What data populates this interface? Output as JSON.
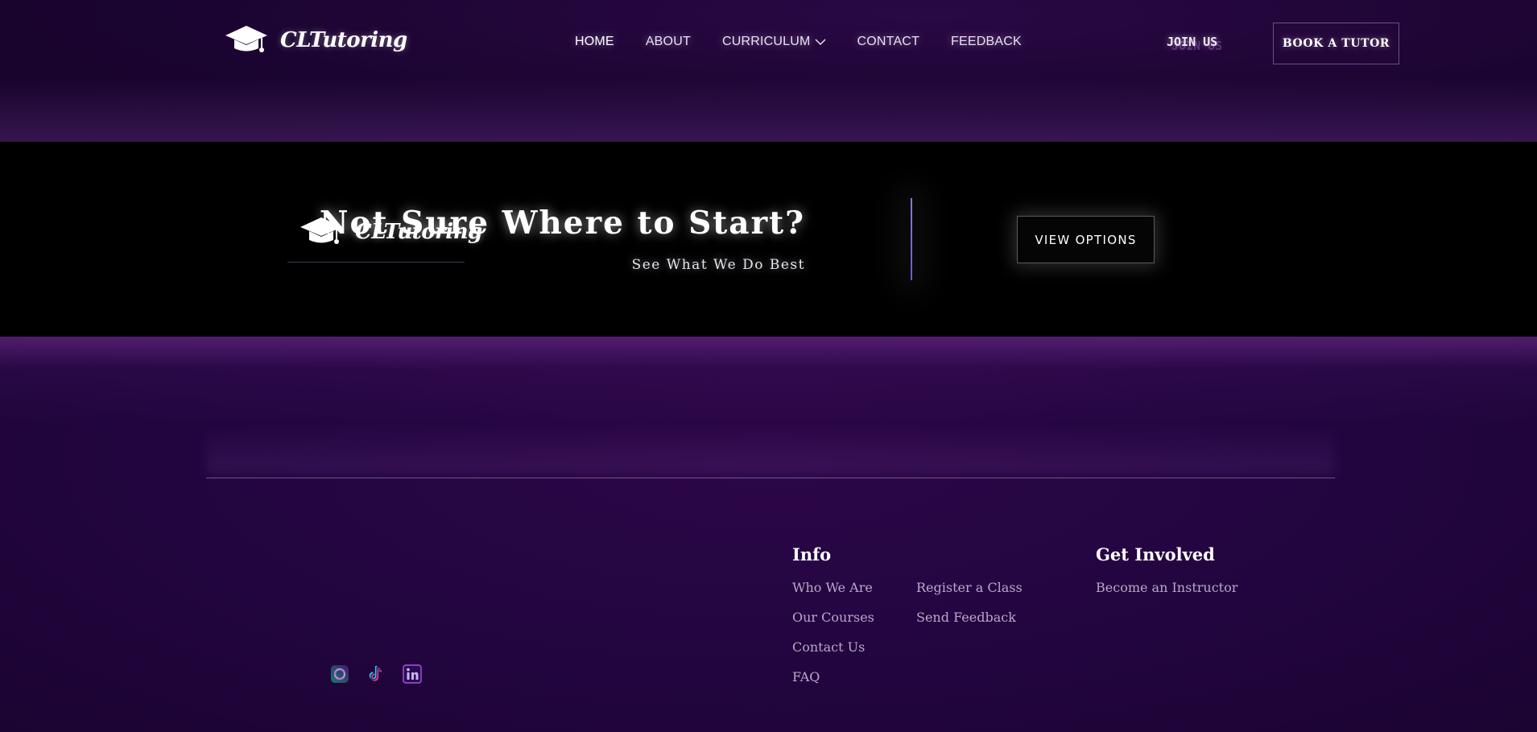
{
  "header": {
    "brand": "CLTutoring",
    "nav": [
      {
        "label": "HOME"
      },
      {
        "label": "ABOUT"
      },
      {
        "label": "CURRICULUM"
      },
      {
        "label": "CONTACT"
      },
      {
        "label": "FEEDBACK"
      }
    ],
    "join_label": "JOIN US",
    "book_label": "BOOK A TUTOR"
  },
  "cta": {
    "title": "Not Sure Where to Start?",
    "subtitle": "See What We Do Best",
    "button_label": "VIEW OPTIONS"
  },
  "footer": {
    "brand": "CLTutoring",
    "info": {
      "title": "Info",
      "links": [
        "Who We Are",
        "Our Courses",
        "Contact Us",
        "FAQ",
        "Register a Class",
        "Send Feedback"
      ]
    },
    "get_involved": {
      "title": "Get Involved",
      "links": [
        "Become an Instructor"
      ]
    },
    "socials": [
      "instagram-icon",
      "tiktok-icon",
      "linkedin-icon"
    ]
  },
  "colors": {
    "background": "#1c0530",
    "band": "#000000",
    "divider": "#8c79d8",
    "text": "#ffffff",
    "link": "#b9a8ca"
  }
}
